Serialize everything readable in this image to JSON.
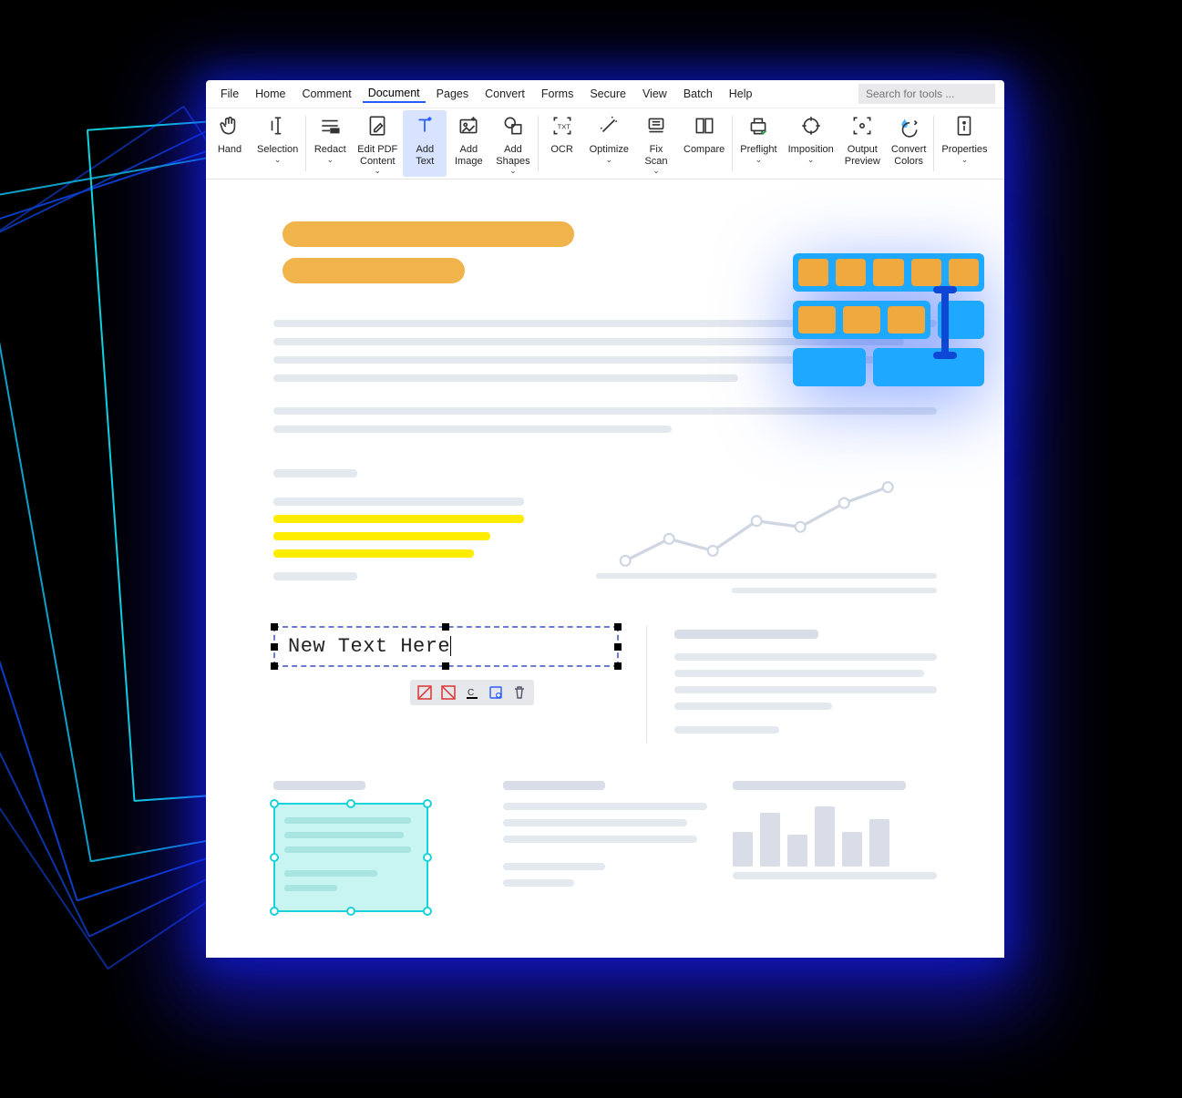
{
  "menu": {
    "items": [
      "File",
      "Home",
      "Comment",
      "Document",
      "Pages",
      "Convert",
      "Forms",
      "Secure",
      "View",
      "Batch",
      "Help"
    ],
    "active": "Document",
    "search_placeholder": "Search for tools ..."
  },
  "toolbar": {
    "hand": "Hand",
    "selection": "Selection",
    "redact": "Redact",
    "edit_pdf": "Edit PDF\nContent",
    "add_text": "Add\nText",
    "add_image": "Add\nImage",
    "add_shapes": "Add\nShapes",
    "ocr": "OCR",
    "optimize": "Optimize",
    "fix_scan": "Fix\nScan",
    "compare": "Compare",
    "preflight": "Preflight",
    "imposition": "Imposition",
    "output_preview": "Output\nPreview",
    "convert_colors": "Convert\nColors",
    "properties": "Properties"
  },
  "doc": {
    "new_text": "New Text Here"
  },
  "ctx": {
    "flip_h": "flip-h",
    "flip_v": "flip-v",
    "color": "font-color",
    "props": "properties",
    "delete": "delete"
  },
  "colors": {
    "accent": "#2a5bff",
    "highlight_orange": "#f1b44c",
    "highlight_yellow": "#ffed00",
    "selection_cyan": "#19d3d8"
  }
}
